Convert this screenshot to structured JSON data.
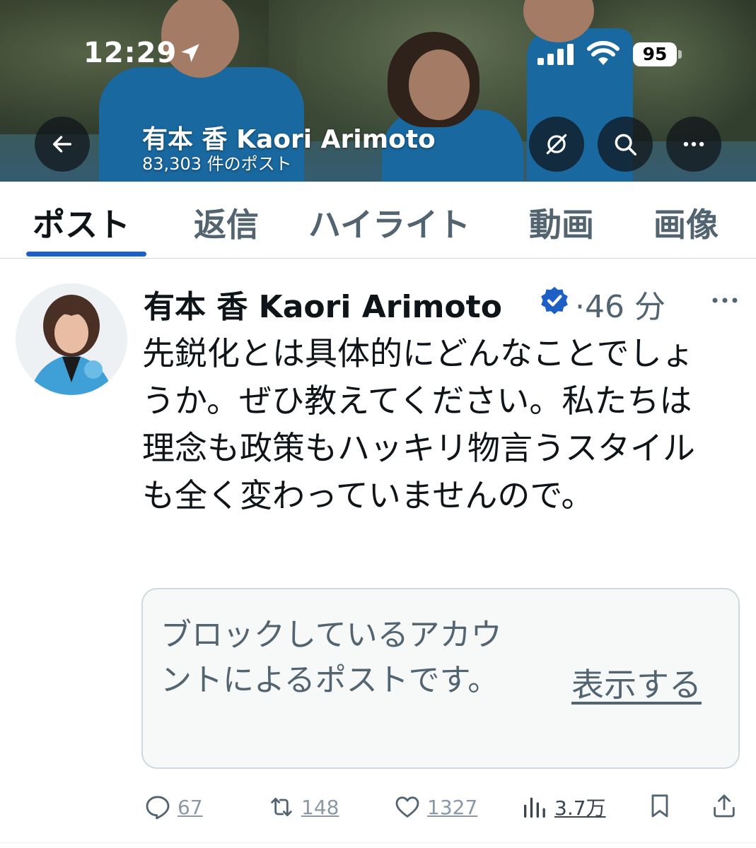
{
  "status_bar": {
    "time": "12:29",
    "battery": "95"
  },
  "header": {
    "display_name": "有本 香 Kaori Arimoto",
    "post_count": "83,303 件のポスト"
  },
  "tabs": [
    {
      "label": "ポスト",
      "active": true
    },
    {
      "label": "返信",
      "active": false
    },
    {
      "label": "ハイライト",
      "active": false
    },
    {
      "label": "動画",
      "active": false
    },
    {
      "label": "画像",
      "active": false
    }
  ],
  "post": {
    "author_name": "有本 香 Kaori Arimoto",
    "time": "·46 分",
    "body": "先鋭化とは具体的にどんなことでしょうか。ぜひ教えてください。私たちは理念も政策もハッキリ物言うスタイルも全く変わっていませんので。",
    "blocked_notice": "ブロックしているアカウントによるポストです。",
    "show_label": "表示する",
    "actions": {
      "replies": "67",
      "reposts": "148",
      "likes": "1327",
      "views": "3.7万"
    }
  },
  "colors": {
    "accent": "#1d5fc4",
    "verified": "#1d5fc4",
    "secondary_text": "#536471",
    "divider": "#cfd9de"
  }
}
